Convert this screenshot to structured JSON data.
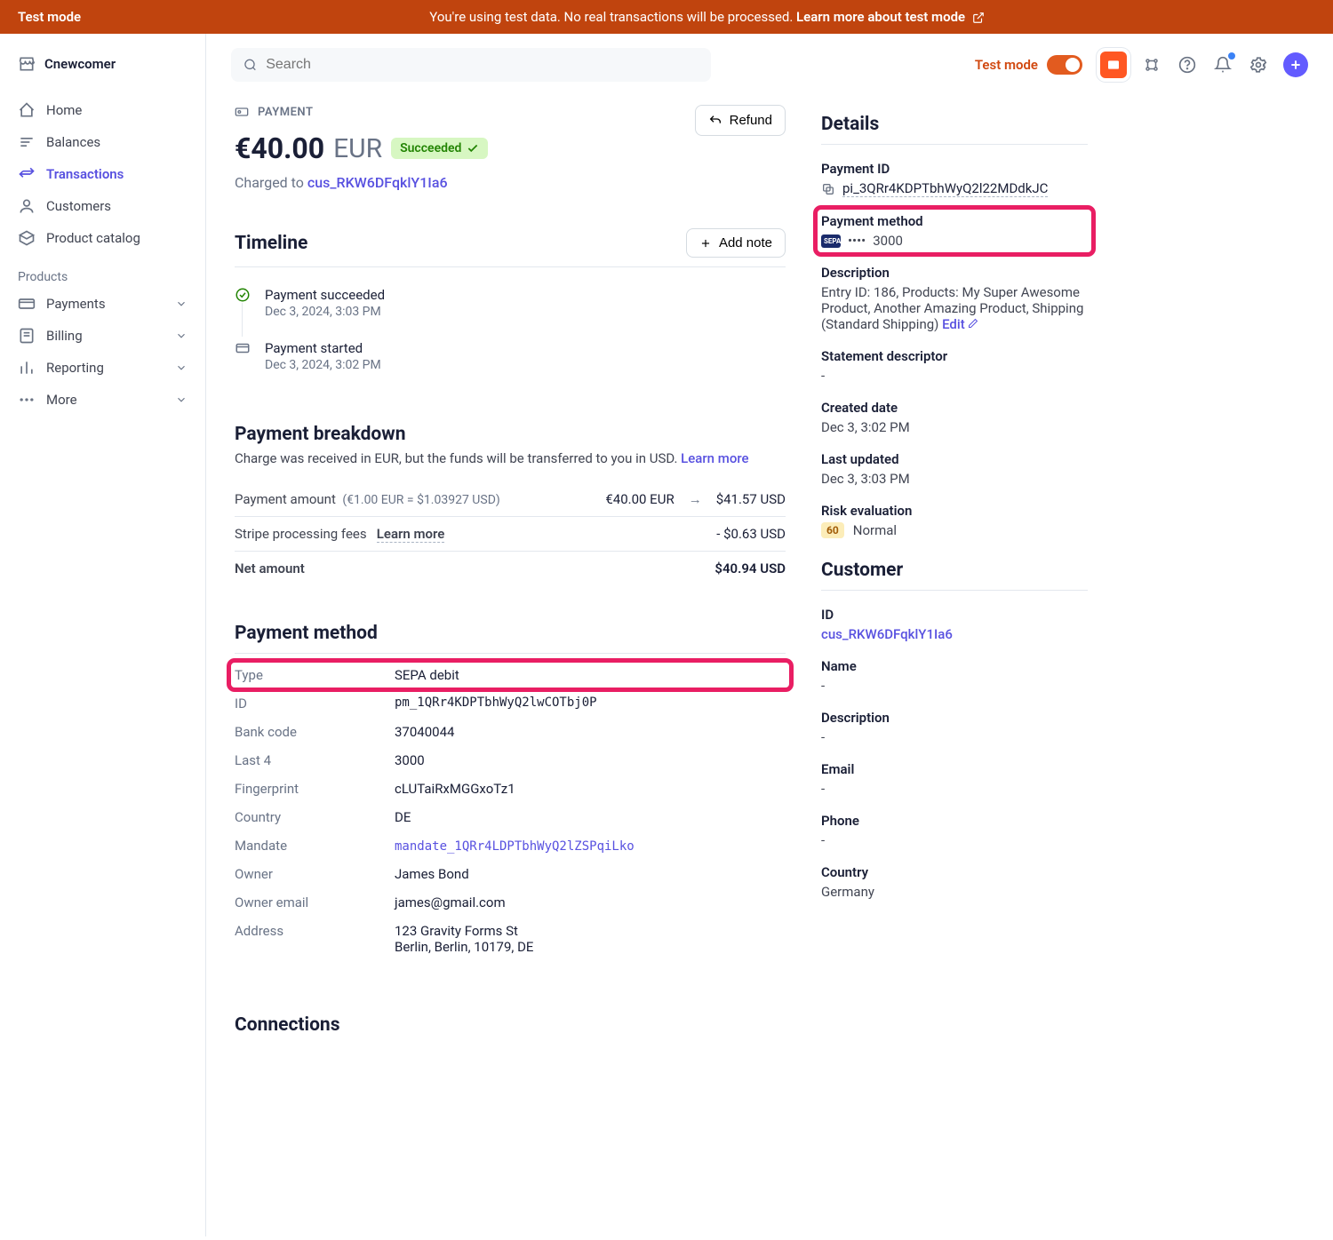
{
  "banner": {
    "title": "Test mode",
    "msg": "You're using test data. No real transactions will be processed. ",
    "link": "Learn more about test mode"
  },
  "workspace": "Cnewcomer",
  "nav": {
    "home": "Home",
    "balances": "Balances",
    "transactions": "Transactions",
    "customers": "Customers",
    "catalog": "Product catalog",
    "products_label": "Products",
    "payments": "Payments",
    "billing": "Billing",
    "reporting": "Reporting",
    "more": "More"
  },
  "search_placeholder": "Search",
  "testmode_label": "Test mode",
  "eyebrow": "PAYMENT",
  "amount": "€40.00",
  "currency": "EUR",
  "status": "Succeeded",
  "charged_to_prefix": "Charged to ",
  "charged_to_id": "cus_RKW6DFqklY1Ia6",
  "refund": "Refund",
  "timeline": {
    "title": "Timeline",
    "add_note": "Add note",
    "items": [
      {
        "title": "Payment succeeded",
        "date": "Dec 3, 2024, 3:03 PM"
      },
      {
        "title": "Payment started",
        "date": "Dec 3, 2024, 3:02 PM"
      }
    ]
  },
  "breakdown": {
    "title": "Payment breakdown",
    "desc": "Charge was received in EUR, but the funds will be transferred to you in USD. ",
    "learn_more": "Learn more",
    "rows": {
      "amount_label": "Payment amount",
      "amount_hint": "(€1.00 EUR = $1.03927 USD)",
      "amount_eur": "€40.00 EUR",
      "amount_usd": "$41.57 USD",
      "fees_label": "Stripe processing fees",
      "fees_learn": "Learn more",
      "fees_val": "- $0.63 USD",
      "net_label": "Net amount",
      "net_val": "$40.94 USD"
    }
  },
  "pm_section": {
    "title": "Payment method",
    "rows": {
      "type_l": "Type",
      "type_v": "SEPA debit",
      "id_l": "ID",
      "id_v": "pm_1QRr4KDPTbhWyQ2lwCOTbj0P",
      "bank_l": "Bank code",
      "bank_v": "37040044",
      "last4_l": "Last 4",
      "last4_v": "3000",
      "fp_l": "Fingerprint",
      "fp_v": "cLUTaiRxMGGxoTz1",
      "country_l": "Country",
      "country_v": "DE",
      "mandate_l": "Mandate",
      "mandate_v": "mandate_1QRr4LDPTbhWyQ2lZSPqiLko",
      "owner_l": "Owner",
      "owner_v": "James Bond",
      "email_l": "Owner email",
      "email_v": "james@gmail.com",
      "address_l": "Address",
      "address_v1": "123 Gravity Forms St",
      "address_v2": "Berlin, Berlin, 10179, DE"
    }
  },
  "connections_title": "Connections",
  "details": {
    "title": "Details",
    "payment_id_l": "Payment ID",
    "payment_id_v": "pi_3QRr4KDPTbhWyQ2l22MDdkJC",
    "pm_l": "Payment method",
    "pm_dots": "••••",
    "pm_last4": "3000",
    "desc_l": "Description",
    "desc_v": "Entry ID: 186, Products: My Super Awesome Product, Another Amazing Product, Shipping (Standard Shipping)  ",
    "edit": "Edit",
    "stmt_l": "Statement descriptor",
    "stmt_v": "-",
    "created_l": "Created date",
    "created_v": "Dec 3, 3:02 PM",
    "updated_l": "Last updated",
    "updated_v": "Dec 3, 3:03 PM",
    "risk_l": "Risk evaluation",
    "risk_score": "60",
    "risk_v": "Normal"
  },
  "customer": {
    "title": "Customer",
    "id_l": "ID",
    "id_v": "cus_RKW6DFqklY1Ia6",
    "name_l": "Name",
    "name_v": "-",
    "desc_l": "Description",
    "desc_v": "-",
    "email_l": "Email",
    "email_v": "-",
    "phone_l": "Phone",
    "phone_v": "-",
    "country_l": "Country",
    "country_v": "Germany"
  }
}
